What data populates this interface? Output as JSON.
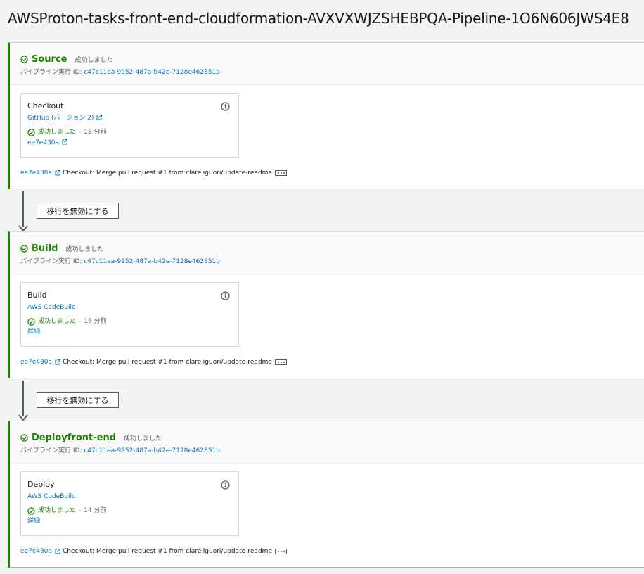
{
  "pipeline": {
    "title": "AWSProton-tasks-front-end-cloudformation-AVXVXWJZSHEBPQA-Pipeline-1O6N606JWS4E8"
  },
  "stages": [
    {
      "name": "Source",
      "status": "成功しました",
      "execution_label": "パイプライン実行 ID: ",
      "execution_id": "c47c11ea-9952-487a-b42e-7128e462851b",
      "action": {
        "name": "Checkout",
        "provider": "GitHub (バージョン 2)",
        "status": "成功しました",
        "separator": "-",
        "time": "18 分前",
        "link": "ee7e430a"
      },
      "commit": {
        "id": "ee7e430a",
        "message": "Checkout: Merge pull request #1 from clareliguori/update-readme"
      }
    },
    {
      "name": "Build",
      "status": "成功しました",
      "execution_label": "パイプライン実行 ID: ",
      "execution_id": "c47c11ea-9952-487a-b42e-7128e462851b",
      "action": {
        "name": "Build",
        "provider": "AWS CodeBuild",
        "status": "成功しました",
        "separator": "-",
        "time": "16 分前",
        "link": "詳細"
      },
      "commit": {
        "id": "ee7e430a",
        "message": "Checkout: Merge pull request #1 from clareliguori/update-readme"
      }
    },
    {
      "name": "Deployfront-end",
      "status": "成功しました",
      "execution_label": "パイプライン実行 ID: ",
      "execution_id": "c47c11ea-9952-487a-b42e-7128e462851b",
      "action": {
        "name": "Deploy",
        "provider": "AWS CodeBuild",
        "status": "成功しました",
        "separator": "-",
        "time": "14 分前",
        "link": "詳細"
      },
      "commit": {
        "id": "ee7e430a",
        "message": "Checkout: Merge pull request #1 from clareliguori/update-readme"
      }
    }
  ],
  "transitions": [
    {
      "button_label": "移行を無効にする"
    },
    {
      "button_label": "移行を無効にする"
    }
  ],
  "colors": {
    "success": "#1d8102",
    "link": "#0073bb",
    "text": "#16191f",
    "muted": "#545b64",
    "background": "#f2f3f3"
  },
  "icons": {
    "status": "check-circle-icon",
    "info": "info-icon",
    "external": "external-link-icon",
    "more": "more-icon",
    "arrow": "arrow-down-icon"
  }
}
